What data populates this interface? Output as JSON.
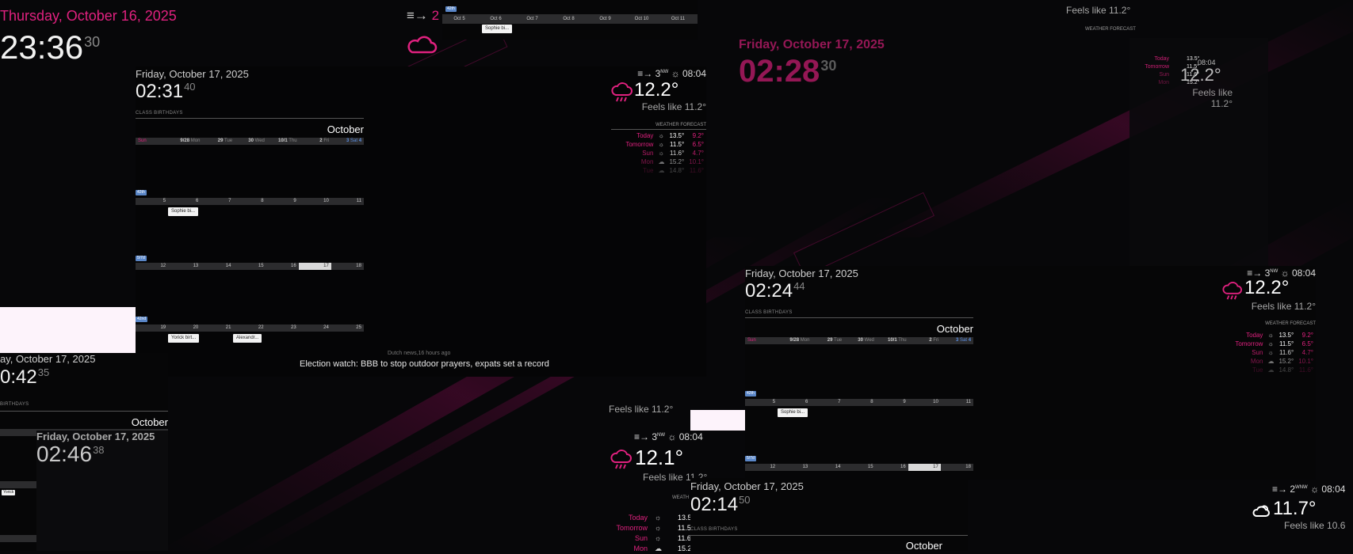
{
  "colors": {
    "accent": "#e0217f",
    "saturday": "#5a8de0",
    "week_badge": "#5a86c7"
  },
  "topleft": {
    "date": "Thursday, October 16, 2025",
    "time": "23:36",
    "sec": "30",
    "wind": "2",
    "icon": "cloud-icon"
  },
  "strip": {
    "week": "42th",
    "days": [
      "Oct 5",
      "Oct 6",
      "Oct 7",
      "Oct 8",
      "Oct 9",
      "Oct 10",
      "Oct 11"
    ],
    "event": "Sophie bi..."
  },
  "main": {
    "date": "Friday, October 17, 2025",
    "time": "02:31",
    "sec": "40",
    "section": "CLASS BIRTHDAYS",
    "month": "October",
    "head": [
      "Sun",
      "9/28",
      "Mon",
      "29",
      "Tue",
      "30",
      "Wed",
      "10/1",
      "Thu",
      "2",
      "Fri",
      "3",
      "Sat",
      "4"
    ],
    "weeks": [
      {
        "badge": "42th",
        "days": [
          "5",
          "6",
          "7",
          "8",
          "9",
          "10",
          "11"
        ],
        "events": [
          "Sophie bi..."
        ]
      },
      {
        "badge": "5/7d",
        "days": [
          "12",
          "13",
          "14",
          "15",
          "16",
          "17",
          "18"
        ],
        "events": []
      },
      {
        "badge": "42nd",
        "days": [
          "19",
          "20",
          "21",
          "22",
          "23",
          "24",
          "25"
        ],
        "events": [
          "Yorick birt...",
          "Alexandr..."
        ]
      }
    ],
    "weather": {
      "wind": "3",
      "wind_dir": "NW",
      "sunrise": "08:04",
      "temp": "12.2°",
      "feels": "Feels like 11.2°",
      "fc_title": "WEATHER FORECAST",
      "forecast": [
        {
          "day": "Today",
          "hi": "13.5°",
          "lo": "9.2°"
        },
        {
          "day": "Tomorrow",
          "hi": "11.5°",
          "lo": "6.5°"
        },
        {
          "day": "Sun",
          "hi": "11.6°",
          "lo": "4.7°"
        },
        {
          "day": "Mon",
          "hi": "15.2°",
          "lo": "10.1°"
        },
        {
          "day": "Tue",
          "hi": "14.8°",
          "lo": "11.6°"
        }
      ]
    },
    "news_src": "Dutch news,16 hours ago",
    "news": "Election watch: BBB to stop outdoor prayers, expats set a record"
  },
  "ghost_top": {
    "date": "Friday, October 17, 2025",
    "time": "02:28",
    "sec": "30",
    "feels": "Feels like 11.2°",
    "fc_title": "WEATHER FORECAST",
    "temp": "12.2°"
  },
  "ghost_small": {
    "days": [
      "Today",
      "Tomorrow",
      "Sun",
      "Mon"
    ],
    "hi": [
      "13.5°",
      "11.5°",
      "11.6°",
      "15.2°"
    ],
    "times": [
      "08:04"
    ],
    "temp": "12.2°",
    "feels1": "Feels like",
    "feels2": "11.2°"
  },
  "right": {
    "date": "Friday, October 17, 2025",
    "time": "02:24",
    "sec": "44",
    "section": "CLASS BIRTHDAYS",
    "month": "October",
    "head": [
      "Sun",
      "9/28",
      "Mon",
      "29",
      "Tue",
      "30",
      "Wed",
      "10/1",
      "Thu",
      "2",
      "Fri",
      "3",
      "Sat",
      "4"
    ],
    "weeks": [
      {
        "badge": "42th",
        "days": [
          "5",
          "6",
          "7",
          "8",
          "9",
          "10",
          "11"
        ],
        "events": [
          "Sophie bi..."
        ]
      },
      {
        "badge": "5/7d",
        "days": [
          "12",
          "13",
          "14",
          "15",
          "16",
          "17",
          "18"
        ],
        "events": []
      }
    ],
    "weather": {
      "wind": "3",
      "wind_dir": "NW",
      "sunrise": "08:04",
      "temp": "12.2°",
      "feels": "Feels like 11.2°",
      "fc_title": "WEATHER FORECAST",
      "forecast": [
        {
          "day": "Today",
          "hi": "13.5°",
          "lo": "9.2°"
        },
        {
          "day": "Tomorrow",
          "hi": "11.5°",
          "lo": "6.5°"
        },
        {
          "day": "Sun",
          "hi": "11.6°",
          "lo": "4.7°"
        },
        {
          "day": "Mon",
          "hi": "15.2°",
          "lo": "10.1°"
        },
        {
          "day": "Tue",
          "hi": "14.8°",
          "lo": "11.6°"
        }
      ]
    }
  },
  "topright": {
    "feels": "Feels like 11.2°",
    "fc_title": "WEATHER FORECAST"
  },
  "leftlow": {
    "date": "ay, October 17, 2025",
    "time": "0:42",
    "sec": "35",
    "section": "BIRTHDAYS",
    "month": "October",
    "overlay_date": "Friday, October 17, 2025",
    "overlay_time": "02:46",
    "overlay_sec": "38",
    "event": "Yorick"
  },
  "midlow": {
    "feels": "Feels like 11.2°",
    "wind": "3",
    "wind_dir": "NW",
    "sunrise": "08:04",
    "temp": "12.1°",
    "feels2": "Feels like 11.2°",
    "fc_title": "WEATH",
    "days": [
      "Today",
      "Tomorrow",
      "Sun",
      "Mon"
    ],
    "hi": [
      "13.5",
      "11.5",
      "11.6",
      "15.2"
    ]
  },
  "bottom": {
    "date": "Friday, October 17, 2025",
    "time": "02:14",
    "sec": "50",
    "section": "CLASS BIRTHDAYS",
    "month": "October"
  },
  "br": {
    "wind": "2",
    "wind_dir": "WNW",
    "sunrise": "08:04",
    "temp": "11.7°",
    "feels": "Feels like 10.6"
  }
}
